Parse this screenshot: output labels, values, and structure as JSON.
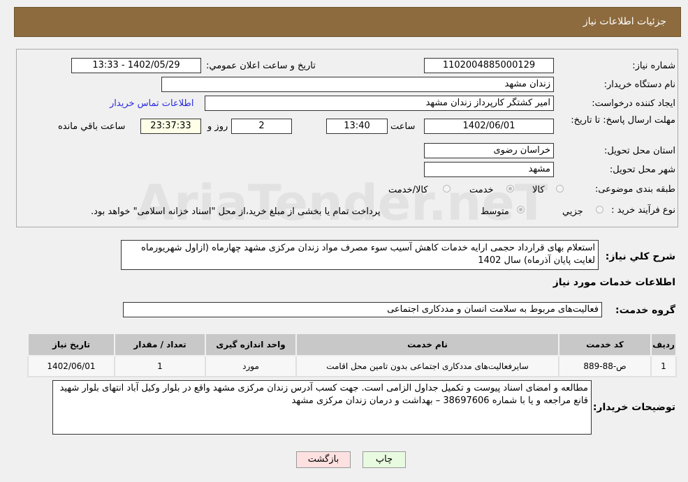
{
  "header": {
    "title": "جزئیات اطلاعات نیاز"
  },
  "form": {
    "need_number_label": "شماره نیاز:",
    "need_number": "1102004885000129",
    "announce_label": "تاریخ و ساعت اعلان عمومي:",
    "announce_value": "1402/05/29 - 13:33",
    "buyer_label": "نام دستگاه خریدار:",
    "buyer": "زندان مشهد",
    "creator_label": "ایجاد کننده درخواست:",
    "creator": "امیر کشتگر کارپرداز زندان مشهد",
    "contact_link": "اطلاعات تماس خریدار",
    "deadline_label": "مهلت ارسال پاسخ: تا تاریخ:",
    "deadline_date": "1402/06/01",
    "time_label": "ساعت",
    "deadline_time": "13:40",
    "days": "2",
    "days_label": "روز و",
    "remaining": "23:37:33",
    "remaining_label": "ساعت باقي مانده",
    "province_label": "استان محل تحویل:",
    "province": "خراسان رضوی",
    "city_label": "شهر محل تحویل:",
    "city": "مشهد",
    "category_label": "طبقه بندی موضوعی:",
    "category_options": [
      "کالا",
      "خدمت",
      "کالا/خدمت"
    ],
    "category_selected": "خدمت",
    "process_label": "نوع فرآیند خرید :",
    "process_options": [
      "جزیي",
      "متوسط"
    ],
    "process_selected": "متوسط",
    "payment_note": "پرداخت تمام یا بخشی از مبلغ خرید،از محل \"اسناد خزانه اسلامی\" خواهد بود."
  },
  "description": {
    "label": "شرح کلي نیاز:",
    "text": "استعلام بهای قرارداد حجمی ارایه خدمات کاهش آسیب سوء مصرف مواد زندان مرکزی مشهد چهارماه (ازاول شهریورماه لغایت پایان آذرماه) سال 1402"
  },
  "services": {
    "title": "اطلاعات خدمات مورد نیاز",
    "group_label": "گروه خدمت:",
    "group": "فعالیت‌های مربوط به سلامت انسان و مددکاری اجتماعی",
    "columns": [
      "ردیف",
      "کد خدمت",
      "نام خدمت",
      "واحد اندازه گیری",
      "تعداد / مقدار",
      "تاریخ نیاز"
    ],
    "rows": [
      [
        "1",
        "ص-88-889",
        "سایرفعالیت‌های مددکاری اجتماعی بدون تامین محل اقامت",
        "مورد",
        "1",
        "1402/06/01"
      ]
    ]
  },
  "notes": {
    "label": "توضیحات خریدار:",
    "text": "مطالعه و امضای اسناد پیوست و تکمیل جداول الزامی است. جهت کسب آدرس زندان مرکزی مشهد واقع در بلوار وکیل آباد انتهای بلوار شهید قانع مراجعه و یا با شماره 38697606 – بهداشت و درمان زندان مرکزی مشهد"
  },
  "buttons": {
    "print": "چاپ",
    "back": "بازگشت"
  },
  "watermark": "AriaTender.neT"
}
